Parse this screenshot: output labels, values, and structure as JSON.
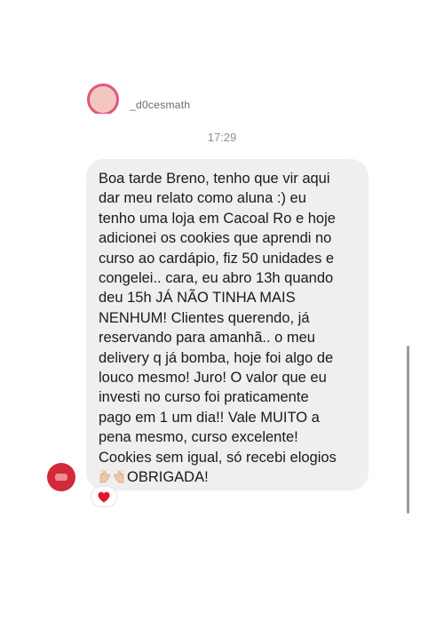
{
  "header": {
    "username": "_d0cesmath",
    "avatar": "profile-avatar"
  },
  "thread": {
    "timestamp": "17:29",
    "message": {
      "text": "Boa tarde Breno, tenho que vir aqui\ndar meu relato como aluna :) eu\ntenho uma loja em Cacoal Ro e hoje\nadicionei os cookies que aprendi no\ncurso ao cardápio, fiz 50 unidades e\ncongelei.. cara, eu abro 13h quando\ndeu 15h JÁ NÃO TINHA MAIS\nNENHUM! Clientes querendo, já\nreservando para amanhã.. o meu\ndelivery q já bomba, hoje foi algo de\nlouco mesmo! Juro! O valor que eu\ninvesti no curso foi praticamente\npago em 1 um dia!! Vale MUITO a\npena mesmo, curso excelente!\nCookies sem igual, só recebi elogios",
      "closing": "OBRIGADA!",
      "emoji": "raising-hands-emoji"
    },
    "reaction": {
      "emoji": "red-heart-icon",
      "color": "#e0162b"
    }
  },
  "colors": {
    "bubble": "#efefef",
    "text": "#1a1a1a",
    "timestamp": "#8e8e8e",
    "avatar_ring": "#e0567a"
  }
}
